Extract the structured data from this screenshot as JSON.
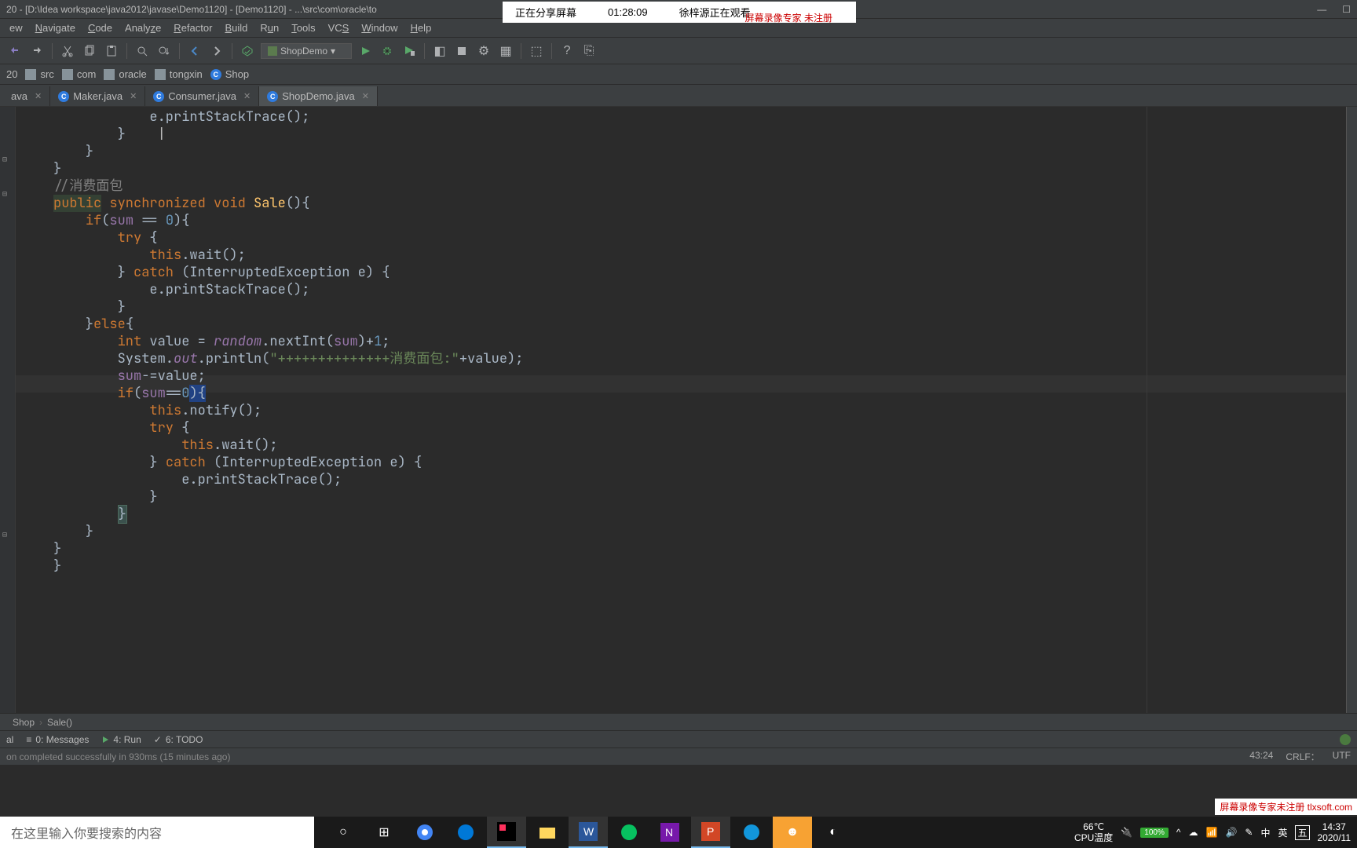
{
  "title": "20 - [D:\\Idea workspace\\java2012\\javase\\Demo1120] - [Demo1120] - ...\\src\\com\\oracle\\to",
  "share": {
    "sharing": "正在分享屏幕",
    "time": "01:28:09",
    "watching": "徐梓源正在观看",
    "rec": "屏幕录像专家 未注册"
  },
  "menu": [
    "ew",
    "Navigate",
    "Code",
    "Analyze",
    "Refactor",
    "Build",
    "Run",
    "Tools",
    "VCS",
    "Window",
    "Help"
  ],
  "run_config": "ShopDemo",
  "breadcrumb": [
    {
      "icon": "module",
      "label": "20"
    },
    {
      "icon": "folder",
      "label": "src"
    },
    {
      "icon": "folder",
      "label": "com"
    },
    {
      "icon": "folder",
      "label": "oracle"
    },
    {
      "icon": "folder",
      "label": "tongxin"
    },
    {
      "icon": "class",
      "label": "Shop"
    }
  ],
  "tabs": [
    {
      "label": "ava",
      "active": false
    },
    {
      "label": "Maker.java",
      "active": false
    },
    {
      "label": "Consumer.java",
      "active": false
    },
    {
      "label": "ShopDemo.java",
      "active": true
    }
  ],
  "code": {
    "comment": "//消费面包",
    "sig_public": "public",
    "sig_sync": "synchronized void",
    "sig_name": "Sale",
    "if1": "if",
    "sum": "sum",
    "try": "try",
    "this": "this",
    "wait": "wait",
    "catch": "catch",
    "exc": "(InterruptedException e) {",
    "pst": "e.printStackTrace();",
    "else": "else",
    "int": "int",
    "value": "value = ",
    "random": "random",
    "nextInt": ".nextInt(",
    "plus1": ")+",
    "one": "1",
    "semi": ";",
    "sout": "System.",
    "out": "out",
    "println": ".println(",
    "str": "\"++++++++++++++消费面包:\"",
    "plusval": "+value);",
    "summinus": "-=value;",
    "sumeq0": "==",
    "zero": "0",
    "notify": "notify"
  },
  "status_crumb": {
    "class": "Shop",
    "method": "Sale()"
  },
  "bottom_tabs": {
    "terminal": "al",
    "messages": "0: Messages",
    "run": "4: Run",
    "todo": "6: TODO"
  },
  "status_msg": "on completed successfully in 930ms (15 minutes ago)",
  "status_right": {
    "pos": "43:24",
    "crlf": "CRLF：",
    "enc": "UTF"
  },
  "search_placeholder": "在这里输入你要搜索的内容",
  "tray": {
    "temp": "66℃",
    "templabel": "CPU温度",
    "battery": "100%",
    "ime1": "中",
    "ime2": "英",
    "ime3": "五",
    "time": "14:37",
    "date": "2020/11"
  },
  "watermark": "屏幕录像专家未注册 tlxsoft.com"
}
